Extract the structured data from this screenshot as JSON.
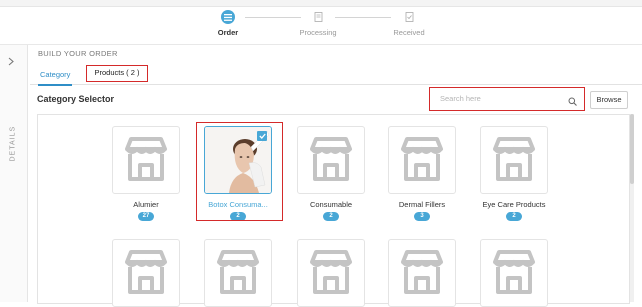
{
  "steps": [
    {
      "label": "Order",
      "icon": "list-icon",
      "active": true
    },
    {
      "label": "Processing",
      "icon": "document-icon",
      "active": false
    },
    {
      "label": "Received",
      "icon": "document-check-icon",
      "active": false
    }
  ],
  "sidepanel": {
    "label": "DETAILS",
    "toggle_icon": "chevron-right-icon"
  },
  "build_title": "BUILD YOUR ORDER",
  "tabs": {
    "category": "Category",
    "products": "Products ( 2 )"
  },
  "selector_title": "Category Selector",
  "search": {
    "placeholder": "Search here",
    "icon": "search-icon"
  },
  "browse_label": "Browse",
  "colors": {
    "accent": "#48a7d6",
    "highlight": "#d42a2a"
  },
  "categories": [
    {
      "name": "Alumier",
      "count": "27",
      "selected": false,
      "image": "store-icon"
    },
    {
      "name": "Botox Consuma...",
      "count": "2",
      "selected": true,
      "image": "product-photo"
    },
    {
      "name": "Consumable",
      "count": "2",
      "selected": false,
      "image": "store-icon"
    },
    {
      "name": "Dermal Fillers",
      "count": "3",
      "selected": false,
      "image": "store-icon"
    },
    {
      "name": "Eye Care Products",
      "count": "2",
      "selected": false,
      "image": "store-icon"
    }
  ],
  "second_row_placeholders": 5
}
